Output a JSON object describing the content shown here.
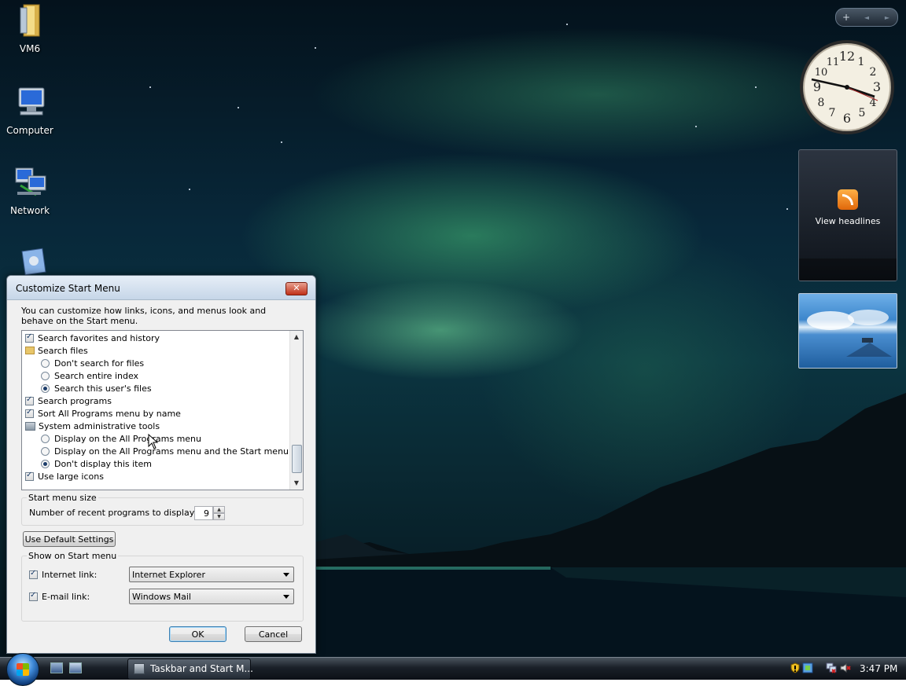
{
  "desktop": {
    "icons": [
      {
        "label": "VM6"
      },
      {
        "label": "Computer"
      },
      {
        "label": "Network"
      },
      {
        "label": ""
      }
    ]
  },
  "sidebar": {
    "controls": {
      "add": "+",
      "prev": "◄",
      "next": "►"
    },
    "clock": {
      "numbers": [
        "12",
        "1",
        "2",
        "3",
        "4",
        "5",
        "6",
        "7",
        "8",
        "9",
        "10",
        "11"
      ]
    },
    "feed": {
      "label": "View headlines"
    },
    "slideshow": {
      "label": ""
    }
  },
  "dialog": {
    "title": "Customize Start Menu",
    "close_label": "✕",
    "description": "You can customize how links, icons, and menus look and behave on the Start menu.",
    "options": [
      {
        "label": "Search favorites and history",
        "kind": "checkbox",
        "checked": true
      },
      {
        "label": "Search files",
        "kind": "folder"
      },
      {
        "label": "Don't search for files",
        "kind": "radio",
        "checked": false
      },
      {
        "label": "Search entire index",
        "kind": "radio",
        "checked": false
      },
      {
        "label": "Search this user's files",
        "kind": "radio",
        "checked": true
      },
      {
        "label": "Search programs",
        "kind": "checkbox",
        "checked": true
      },
      {
        "label": "Sort All Programs menu by name",
        "kind": "checkbox",
        "checked": true
      },
      {
        "label": "System administrative tools",
        "kind": "tools"
      },
      {
        "label": "Display on the All Programs menu",
        "kind": "radio",
        "checked": false
      },
      {
        "label": "Display on the All Programs menu and the Start menu",
        "kind": "radio",
        "checked": false
      },
      {
        "label": "Don't display this item",
        "kind": "radio",
        "checked": true
      },
      {
        "label": "Use large icons",
        "kind": "checkbox",
        "checked": true
      }
    ],
    "start_menu_size": {
      "group_label": "Start menu size",
      "recent_label": "Number of recent programs to display:",
      "recent_value": "9"
    },
    "default_button": "Use Default Settings",
    "show_on_start": {
      "group_label": "Show on Start menu",
      "internet_label": "Internet link:",
      "internet_checked": true,
      "internet_value": "Internet Explorer",
      "email_label": "E-mail link:",
      "email_checked": true,
      "email_value": "Windows Mail"
    },
    "ok_label": "OK",
    "cancel_label": "Cancel"
  },
  "taskbar": {
    "task_title": "Taskbar and Start M...",
    "time": "3:47 PM"
  }
}
